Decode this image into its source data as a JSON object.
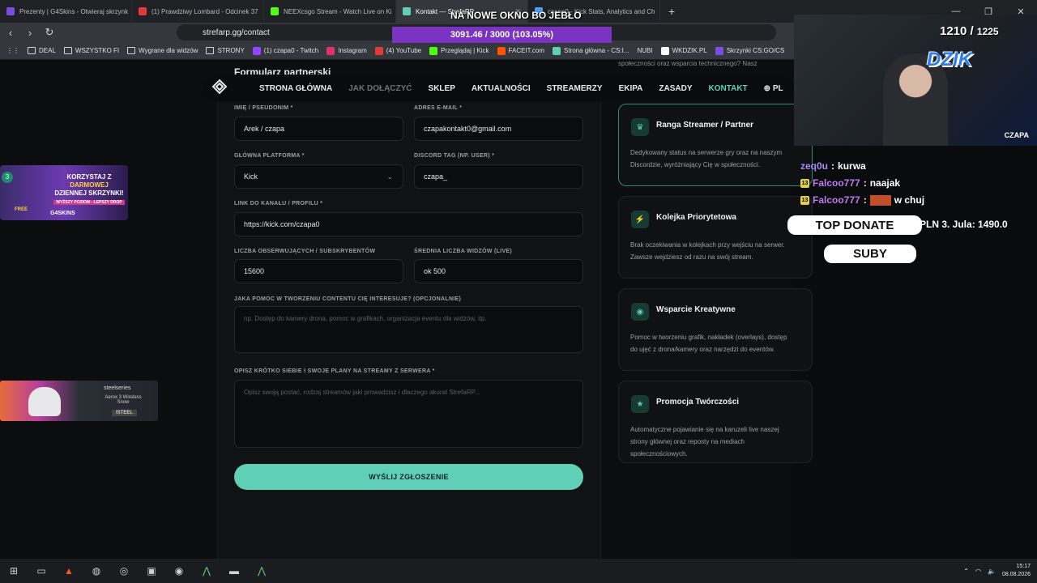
{
  "tabs": [
    {
      "title": "Prezenty | G4Skins - Otwieraj skrzynk",
      "color": "#7a4de0"
    },
    {
      "title": "(1) Prawdziwy Lombard - Odcinek 37",
      "color": "#e23a3a"
    },
    {
      "title": "NEEXcsgo Stream - Watch Live on Ki",
      "color": "#53fc18"
    },
    {
      "title": "Kontakt — StrefaRP",
      "color": "#5fd0b5",
      "active": true
    },
    {
      "title": "czapa0 - Kick Stats, Analytics and Ch",
      "color": "#4aa0ff"
    }
  ],
  "address_bar": {
    "url": "strefarp.gg/contact"
  },
  "bookmarks": [
    "DEAL",
    "WSZYSTKO FI",
    "Wygrane dla widzów",
    "STRONY",
    "(1) czapa0 - Twitch",
    "Instagram",
    "(4) YouTube",
    "Przeglądaj | Kick",
    "FACEIT.com",
    "Strona główna - CS:I...",
    "NUBI",
    "WKDZIK.PL",
    "Skrzynki CS:GO/CS"
  ],
  "site_nav": {
    "items": [
      "STRONA GŁÓWNA",
      "JAK DOŁĄCZYĆ",
      "SKLEP",
      "AKTUALNOŚCI",
      "STREAMERZY",
      "EKIPA",
      "ZASADY",
      "KONTAKT"
    ],
    "lang": "PL"
  },
  "form": {
    "title": "Formularz partnerski",
    "name_label": "IMIĘ / PSEUDONIM *",
    "name_value": "Arek / czapa",
    "email_label": "ADRES E-MAIL *",
    "email_value": "czapakontakt0@gmail.com",
    "platform_label": "GŁÓWNA PLATFORMA *",
    "platform_value": "Kick",
    "discord_label": "DISCORD TAG (NP. USER) *",
    "discord_value": "czapa_",
    "link_label": "LINK DO KANAŁU / PROFILU *",
    "link_value": "https://kick.com/czapa0",
    "followers_label": "LICZBA OBSERWUJĄCYCH / SUBSKRYBENTÓW",
    "followers_value": "15600",
    "viewers_label": "ŚREDNIA LICZBA WIDZÓW (LIVE)",
    "viewers_value": "ok 500",
    "help_label": "JAKA POMOC W TWORZENIU CONTENTU CIĘ INTERESUJE? (OPCJONALNIE)",
    "help_placeholder": "np. Dostęp do kamery drona, pomoc w grafikach, organizacja eventu dla widzów, itp.",
    "plans_label": "OPISZ KRÓTKO SIEBIE I SWOJE PLANY NA STREAMY Z SERWERA *",
    "plans_placeholder": "Opisz swoją postać, rodzaj streamów jaki prowadzisz i dlaczego akurat StrefaRP...",
    "submit": "WYŚLIJ ZGŁOSZENIE"
  },
  "side_top_text": "społeczności oraz wsparcia technicznego? Nasz",
  "features": [
    {
      "title": "Ranga Streamer / Partner",
      "desc": "Dedykowany status na serwerze gry oraz na naszym Discordzie, wyróżniający Cię w społeczności.",
      "icon": "trophy-icon"
    },
    {
      "title": "Kolejka Priorytetowa",
      "desc": "Brak oczekiwania w kolejkach przy wejściu na serwer. Zawsze wejdziesz od razu na swój stream.",
      "icon": "bolt-icon"
    },
    {
      "title": "Wsparcie Kreatywne",
      "desc": "Pomoc w tworzeniu grafik, nakładek (overlays), dostęp do ujęć z drona/kamery oraz narzędzi do eventów.",
      "icon": "camera-icon"
    },
    {
      "title": "Promocja Twórczości",
      "desc": "Automatyczne pojawianie się na karuzeli live naszej strony głównej oraz reposty na mediach społecznościowych.",
      "icon": "star-icon"
    }
  ],
  "ads": {
    "g4skins": {
      "line1": "KORZYSTAJ Z",
      "line1b": "DARMOWEJ",
      "line2": "DZIENNEJ SKRZYNKI!",
      "line3": "WYŻSZY POZIOM - LEPSZY DROP",
      "brand": "G4SKINS",
      "badge": "FREE",
      "level": "3"
    },
    "steelseries": {
      "brand": "steelseries",
      "product": "Aerox 3 Wireless Snow",
      "shop": "ISTEEL"
    }
  },
  "overlay": {
    "top_text": "NA NOWE OKNO BO JEBŁO",
    "progress_text": "3091.46 / 3000 (103.05%)",
    "goal_current": "1210",
    "goal_total": "1225",
    "brand": "DZIK",
    "cam_label": "CZAPA",
    "chat": [
      {
        "user": "zeq0u",
        "msg": "kurwa"
      },
      {
        "user": "Falcoo777",
        "msg": "naajak"
      },
      {
        "user": "Falcoo777",
        "msg": "w chuj"
      }
    ],
    "top_donate": "TOP DONATE",
    "ticker": "PLN 3. Jula: 1490.0",
    "suby": "SUBY"
  },
  "taskbar": {
    "time": "15:17",
    "date": "08.08.2026"
  }
}
